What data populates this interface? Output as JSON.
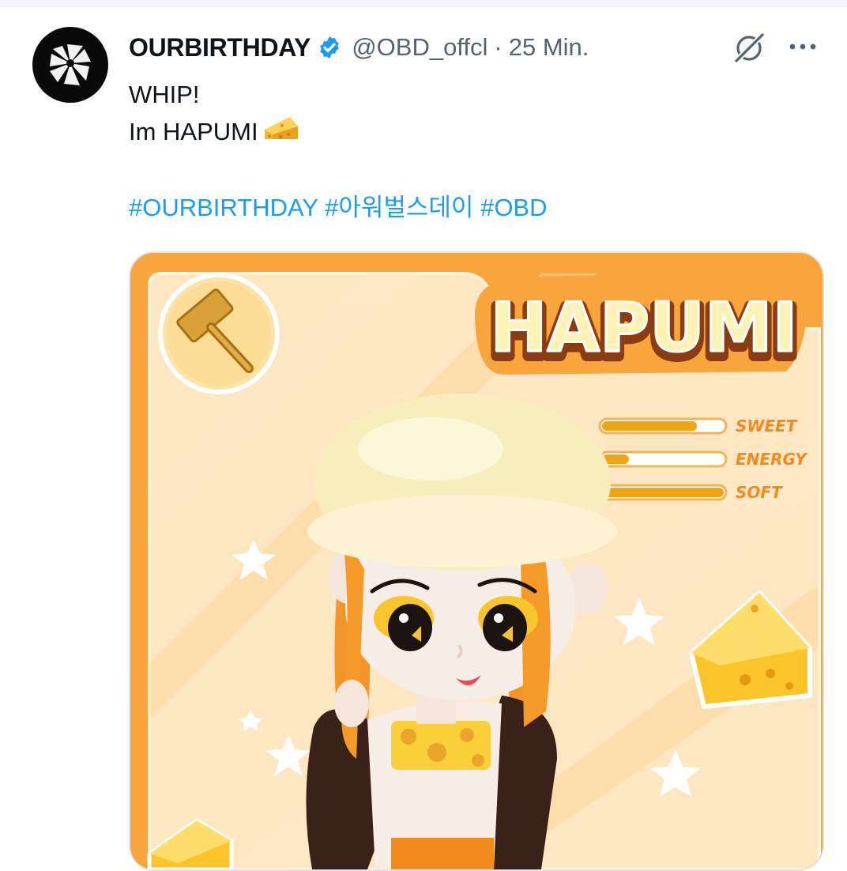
{
  "tweet": {
    "display_name": "OURBIRTHDAY",
    "handle": "@OBD_offcl",
    "separator": "·",
    "time": "25 Min.",
    "text_lines": [
      "WHIP!",
      "Im HAPUMI"
    ],
    "hashtags": [
      "#OURBIRTHDAY",
      "#아워벌스데이",
      "#OBD"
    ]
  },
  "icons": {
    "avatar": "obd-logo-icon",
    "verified": "verified-badge-icon",
    "grok": "grok-icon",
    "more": "more-dots-icon",
    "emoji": "cheese-emoji-icon"
  },
  "card": {
    "title": "HAPUMI",
    "stats": [
      {
        "label": "SWEET",
        "level": 0.78
      },
      {
        "label": "ENERGY",
        "level": 0.22
      },
      {
        "label": "SOFT",
        "level": 1.0
      }
    ],
    "weapon_icon": "hammer-icon"
  },
  "colors": {
    "link": "#1d9bf0",
    "secondary_text": "#536471",
    "card_orange": "#f7a53c",
    "card_cream": "#fde6c2",
    "cheese_yellow": "#fbc42b"
  }
}
